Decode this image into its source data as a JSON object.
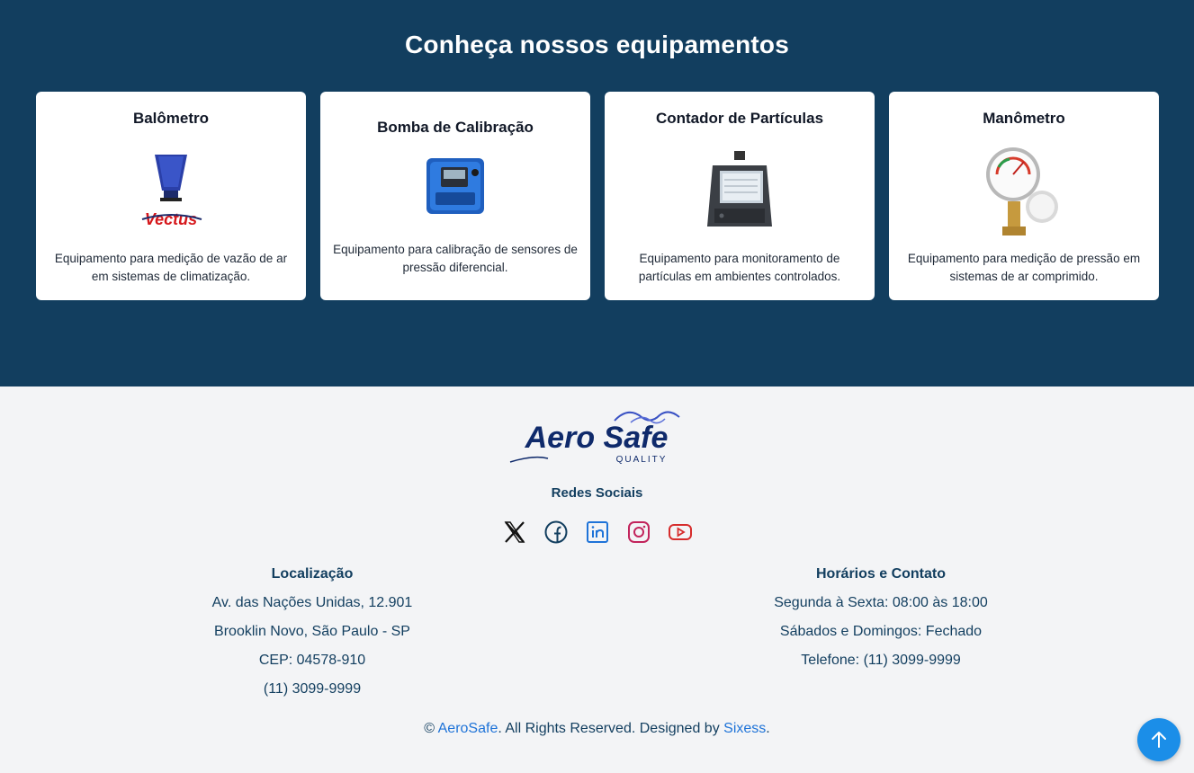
{
  "equipment": {
    "title": "Conheça nossos equipamentos",
    "cards": [
      {
        "title": "Balômetro",
        "desc": "Equipamento para medição de vazão de ar em sistemas de climatização.",
        "brand": "Vectus"
      },
      {
        "title": "Bomba de Calibração",
        "desc": "Equipamento para calibração de sensores de pressão diferencial."
      },
      {
        "title": "Contador de Partículas",
        "desc": "Equipamento para monitoramento de partículas em ambientes controlados."
      },
      {
        "title": "Manômetro",
        "desc": "Equipamento para medição de pressão em sistemas de ar comprimido."
      }
    ]
  },
  "footer": {
    "logo_text": "Aero Safe",
    "logo_sub": "QUALITY",
    "social_title": "Redes Sociais",
    "social_icons": [
      "x-icon",
      "facebook-icon",
      "linkedin-icon",
      "instagram-icon",
      "youtube-icon"
    ],
    "location": {
      "title": "Localização",
      "lines": [
        "Av. das Nações Unidas, 12.901",
        "Brooklin Novo, São Paulo - SP",
        "CEP: 04578-910",
        "(11) 3099-9999"
      ]
    },
    "hours": {
      "title": "Horários e Contato",
      "lines": [
        "Segunda à Sexta: 08:00 às 18:00",
        "Sábados e Domingos: Fechado",
        "Telefone: (11) 3099-9999"
      ]
    },
    "copyright": {
      "prefix": "© ",
      "brand": "AeroSafe",
      "middle": ". All Rights Reserved. Designed by ",
      "designer": "Sixess",
      "suffix": "."
    }
  },
  "colors": {
    "navy": "#123e5f",
    "accent": "#1b8ee8",
    "link": "#1e73d8"
  }
}
